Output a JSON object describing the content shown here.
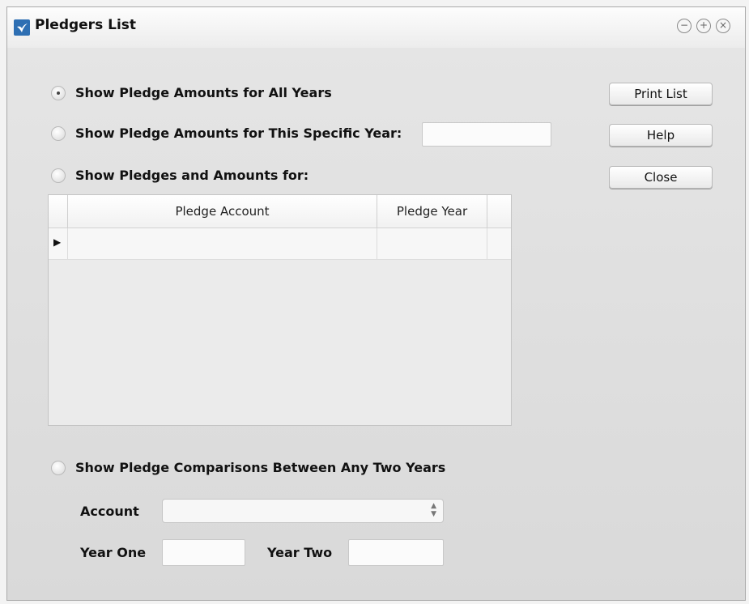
{
  "window": {
    "title": "Pledgers List",
    "controls": {
      "minimize": "−",
      "maximize": "+",
      "close": "×"
    }
  },
  "options": {
    "all_years": "Show Pledge Amounts for All Years",
    "specific_year": "Show Pledge Amounts for This Specific Year:",
    "pledges_amounts": "Show Pledges and Amounts for:",
    "comparisons": "Show Pledge Comparisons Between Any Two Years",
    "selected": "all_years"
  },
  "specific_year_value": "",
  "buttons": {
    "print_list": "Print List",
    "help": "Help",
    "close": "Close"
  },
  "grid": {
    "columns": [
      "Pledge Account",
      "Pledge Year"
    ],
    "rows": [
      {
        "pledge_account": "",
        "pledge_year": ""
      }
    ],
    "row_indicator": "▶"
  },
  "comparison": {
    "account_label": "Account",
    "account_value": "",
    "year_one_label": "Year One",
    "year_one_value": "",
    "year_two_label": "Year Two",
    "year_two_value": ""
  }
}
